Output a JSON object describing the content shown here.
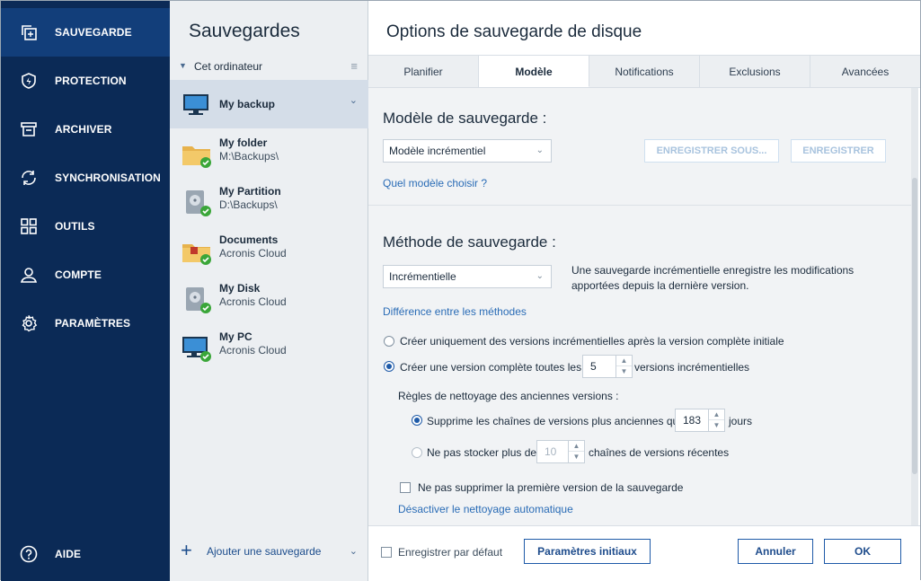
{
  "nav": {
    "items": [
      {
        "label": "SAUVEGARDE",
        "icon": "copy-icon"
      },
      {
        "label": "PROTECTION",
        "icon": "shield-icon"
      },
      {
        "label": "ARCHIVER",
        "icon": "archive-box-icon"
      },
      {
        "label": "SYNCHRONISATION",
        "icon": "sync-icon"
      },
      {
        "label": "OUTILS",
        "icon": "grid-icon"
      },
      {
        "label": "COMPTE",
        "icon": "user-icon"
      },
      {
        "label": "PARAMÈTRES",
        "icon": "gear-icon"
      }
    ],
    "help": {
      "label": "AIDE",
      "icon": "question-icon"
    }
  },
  "list": {
    "title": "Sauvegardes",
    "group": "Cet ordinateur",
    "items": [
      {
        "name": "My backup",
        "path": "",
        "icon": "monitor-icon"
      },
      {
        "name": "My folder",
        "path": "M:\\Backups\\",
        "icon": "folder-icon"
      },
      {
        "name": "My Partition",
        "path": "D:\\Backups\\",
        "icon": "disk-icon"
      },
      {
        "name": "Documents",
        "path": "Acronis Cloud",
        "icon": "briefcase-icon"
      },
      {
        "name": "My Disk",
        "path": "Acronis Cloud",
        "icon": "disk-icon"
      },
      {
        "name": "My PC",
        "path": "Acronis Cloud",
        "icon": "monitor-icon"
      }
    ],
    "add_label": "Ajouter une sauvegarde"
  },
  "panel": {
    "title": "Options de sauvegarde de disque",
    "tabs": [
      "Planifier",
      "Modèle",
      "Notifications",
      "Exclusions",
      "Avancées"
    ],
    "active_tab": "Modèle",
    "scheme": {
      "heading": "Modèle de sauvegarde :",
      "select_value": "Modèle incrémentiel",
      "save_as_label": "ENREGISTRER SOUS...",
      "save_label": "ENREGISTRER",
      "help_link": "Quel modèle choisir ?"
    },
    "method": {
      "heading": "Méthode de sauvegarde :",
      "select_value": "Incrémentielle",
      "description": "Une sauvegarde incrémentielle enregistre les modifications apportées depuis la dernière version.",
      "diff_link": "Différence entre les méthodes",
      "option1": "Créer uniquement des versions incrémentielles après la version complète initiale",
      "option2_prefix": "Créer une version complète toutes les",
      "option2_value": "5",
      "option2_suffix": "versions incrémentielles",
      "cleanup_label": "Règles de nettoyage des anciennes versions :",
      "cleanup1_prefix": "Supprime les chaînes de versions plus anciennes que",
      "cleanup1_value": "183",
      "cleanup1_suffix": "jours",
      "cleanup2_prefix": "Ne pas stocker plus de",
      "cleanup2_value": "10",
      "cleanup2_suffix": "chaînes de versions récentes",
      "keep_first": "Ne pas supprimer la première version de la sauvegarde",
      "disable_link": "Désactiver le nettoyage automatique"
    },
    "footer": {
      "default_label": "Enregistrer par défaut",
      "reset_label": "Paramètres initiaux",
      "cancel_label": "Annuler",
      "ok_label": "OK"
    }
  },
  "colors": {
    "nav_bg": "#0b2a56",
    "nav_active": "#123e7a",
    "accent": "#1e5aa8",
    "link": "#2a6cb6",
    "success": "#3aa639"
  }
}
